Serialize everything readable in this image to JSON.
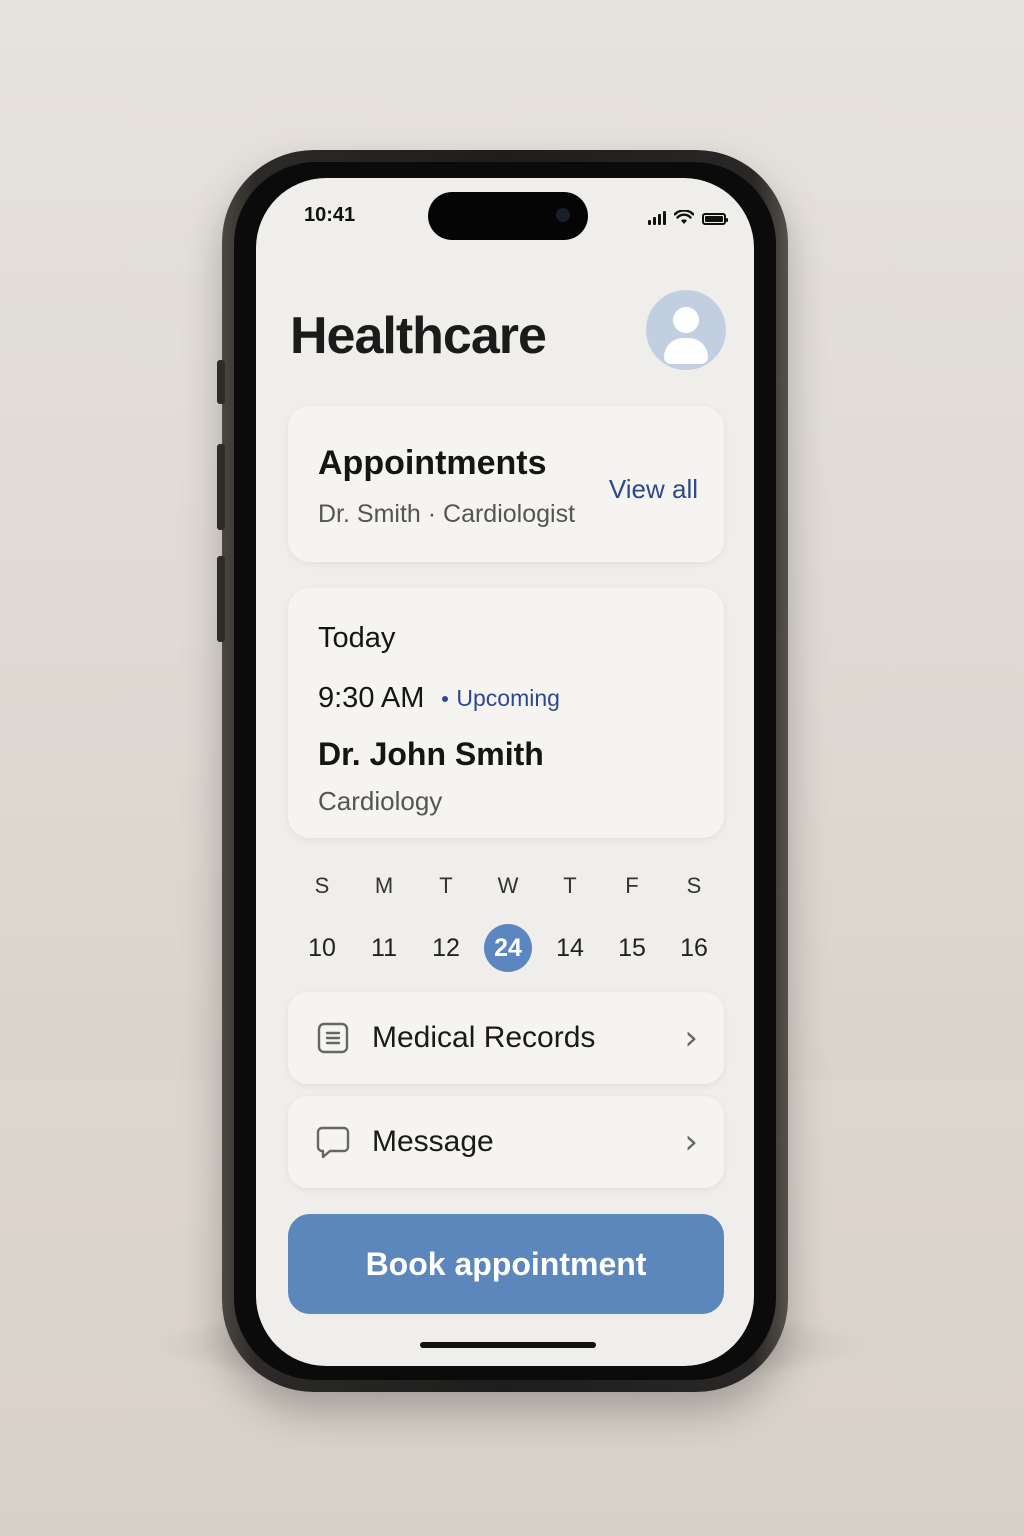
{
  "status_bar": {
    "time": "10:41"
  },
  "header": {
    "title": "Healthcare",
    "avatar_icon": "user-avatar-icon"
  },
  "appointments_card": {
    "heading": "Appointments",
    "subtitle": "Dr. Smith · Cardiologist",
    "view_all_label": "View all"
  },
  "today_card": {
    "label": "Today",
    "time": "9:30 AM",
    "status": "Upcoming",
    "doctor": "Dr. John Smith",
    "specialty": "Cardiology"
  },
  "calendar": {
    "weekdays": [
      "S",
      "M",
      "T",
      "W",
      "T",
      "F",
      "S"
    ],
    "dates": [
      "10",
      "11",
      "12",
      "24",
      "14",
      "15",
      "16"
    ],
    "selected_index": 3
  },
  "menu": {
    "medical_records_label": "Medical Records",
    "medical_records_icon": "document-icon",
    "message_label": "Message",
    "message_icon": "chat-bubble-icon"
  },
  "cta": {
    "book_label": "Book appointment"
  },
  "colors": {
    "accent": "#5c87bd",
    "link": "#2b4a8a",
    "avatar_bg": "#c1cfe0",
    "screen_bg": "#f0eeea"
  }
}
